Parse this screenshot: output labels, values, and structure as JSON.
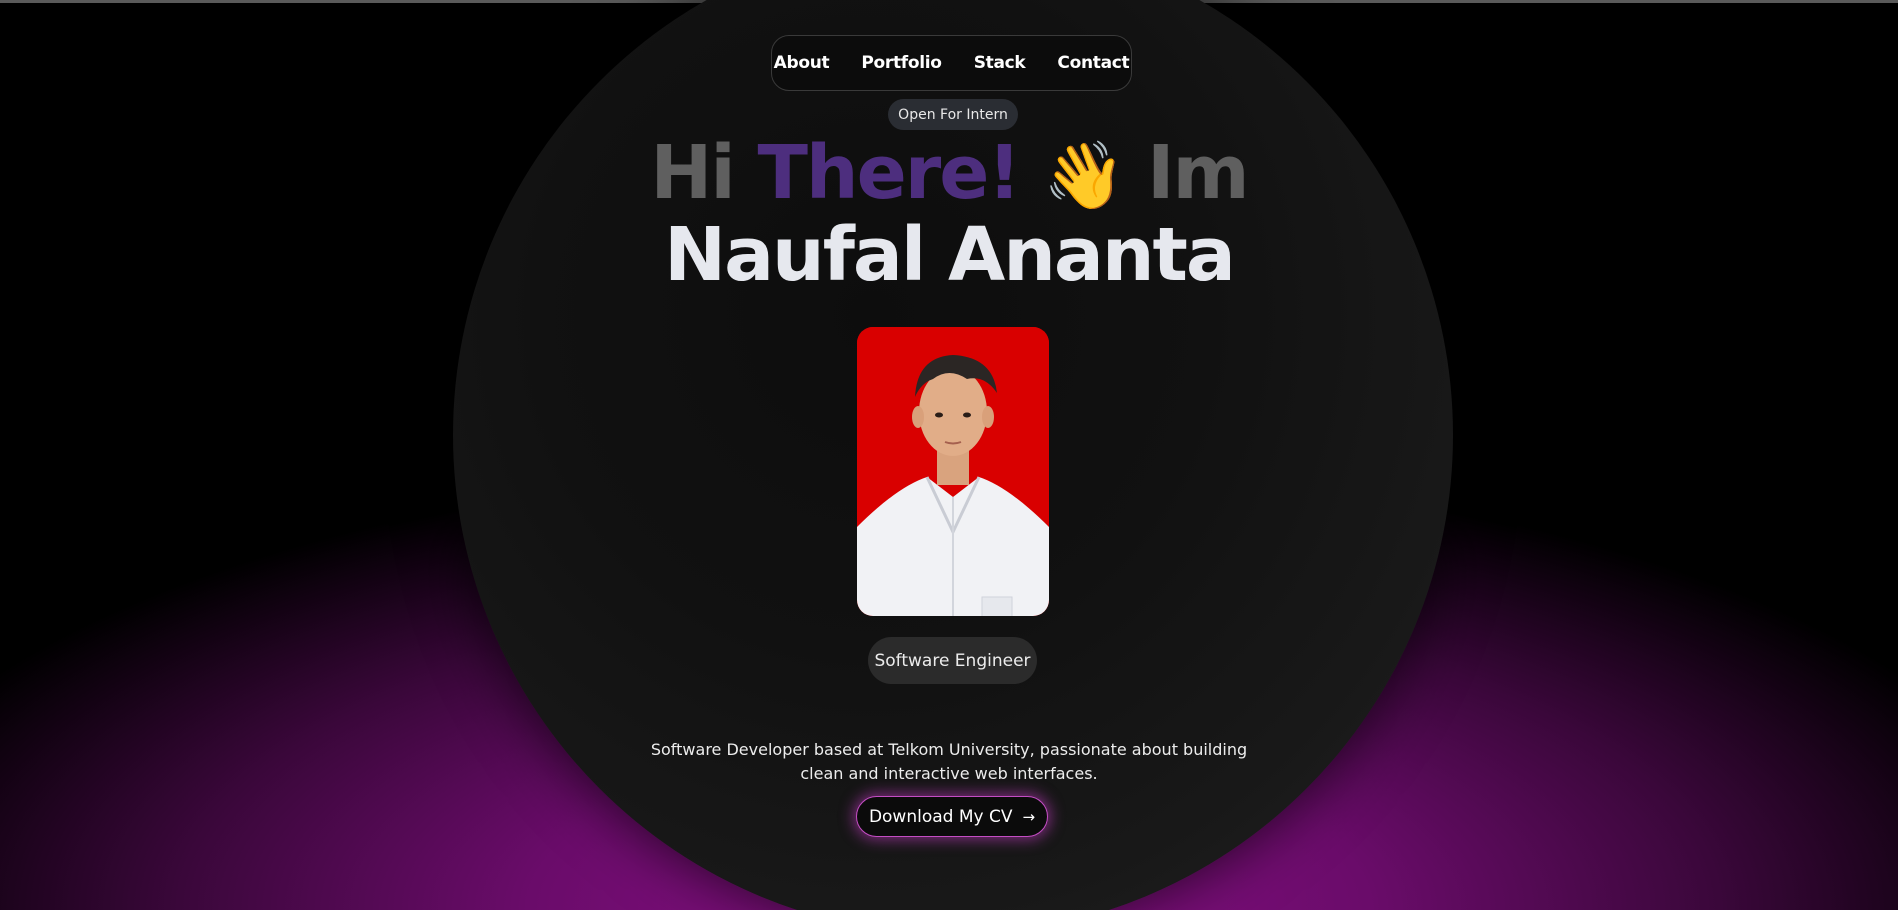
{
  "nav": {
    "items": [
      {
        "label": "About"
      },
      {
        "label": "Portfolio"
      },
      {
        "label": "Stack"
      },
      {
        "label": "Contact"
      }
    ]
  },
  "badge": {
    "label": "Open For Intern"
  },
  "hero": {
    "hi": "Hi",
    "there": "There!",
    "wave": "👋",
    "im": "Im",
    "name": "Naufal Ananta"
  },
  "profile": {
    "photo_alt": "Naufal Ananta",
    "role": "Software Engineer"
  },
  "description": "Software Developer based at Telkom University, passionate about building clean and interactive web interfaces.",
  "cta": {
    "label": "Download My CV",
    "icon": "arrow-right-icon"
  },
  "colors": {
    "accent_purple": "#4d2e7e",
    "glow_magenta": "#8a1187",
    "photo_bg": "#d90000"
  }
}
